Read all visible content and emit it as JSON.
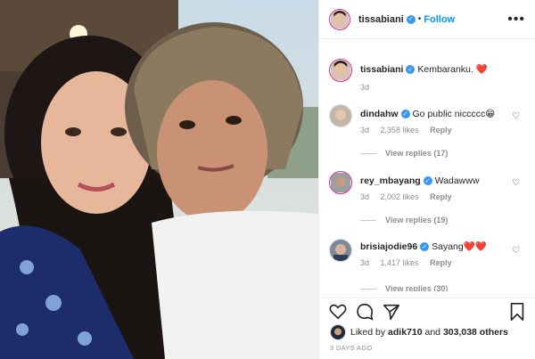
{
  "post_author": {
    "username": "tissabiani",
    "follow_label": "Follow",
    "separator": "•"
  },
  "caption": {
    "username": "tissabiani",
    "text": "Kembaranku. ❤️",
    "age": "3d"
  },
  "comments": [
    {
      "username": "dindahw",
      "text": "Go public niccccc😁",
      "age": "3d",
      "likes": "2,358 likes",
      "reply_label": "Reply",
      "view_replies": "View replies (17)"
    },
    {
      "username": "rey_mbayang",
      "text": "Wadawww",
      "age": "3d",
      "likes": "2,002 likes",
      "reply_label": "Reply",
      "view_replies": "View replies (19)"
    },
    {
      "username": "brisiajodie96",
      "text": "Sayang❤️❤️",
      "age": "3d",
      "likes": "1,417 likes",
      "reply_label": "Reply",
      "view_replies": "View replies (30)"
    }
  ],
  "likes_summary": {
    "prefix": "Liked by",
    "user": "adik710",
    "middle": "and",
    "count": "303,038 others"
  },
  "timestamp": "3 DAYS AGO",
  "icons": {
    "like": "heart-icon",
    "comment": "comment-icon",
    "share": "share-icon",
    "save": "bookmark-icon",
    "more": "more-options-icon"
  },
  "colors": {
    "accent": "#0095f6",
    "verified": "#3897f0",
    "muted": "#8e8e8e",
    "heart": "#e0245e"
  }
}
